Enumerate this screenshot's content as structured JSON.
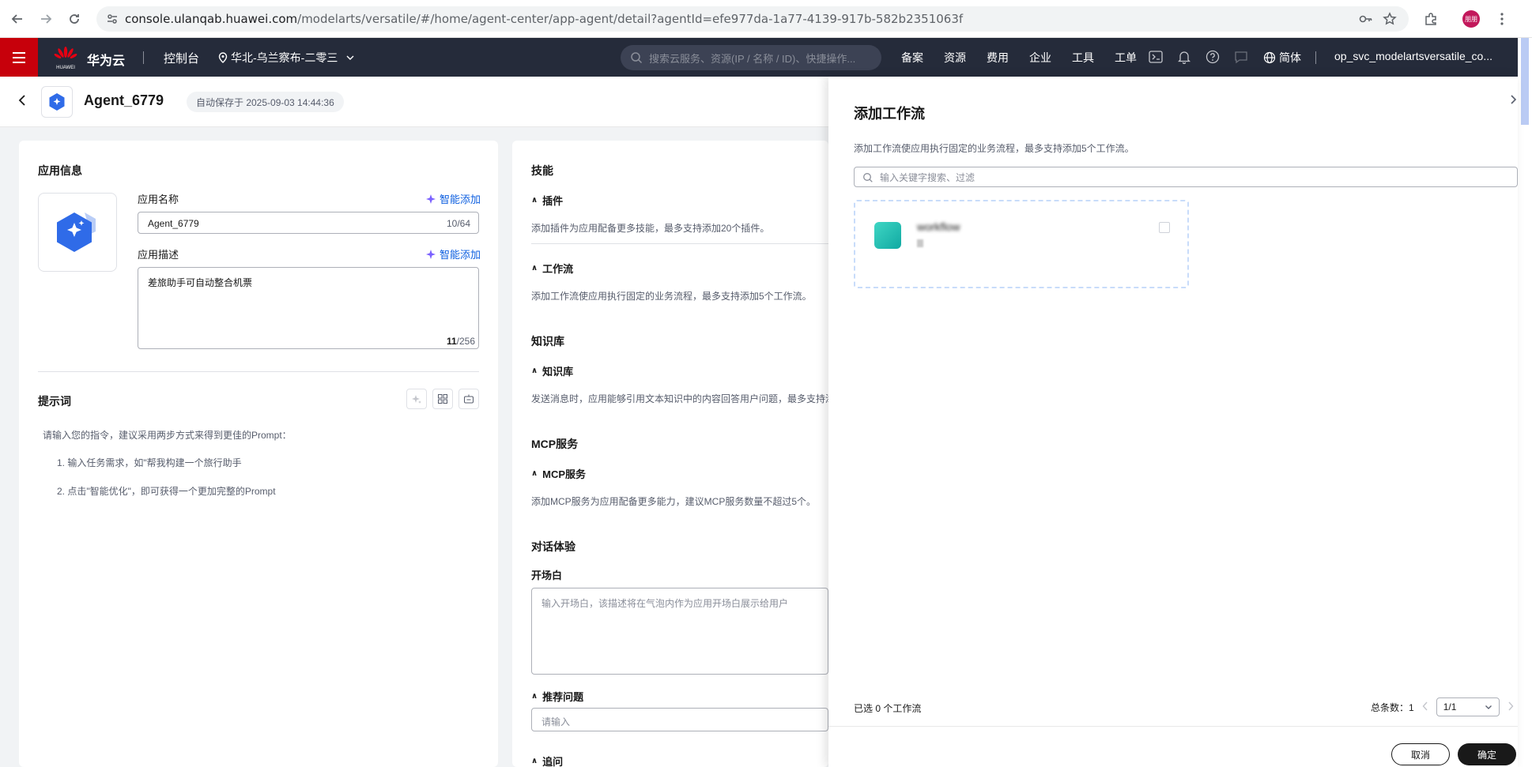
{
  "browser": {
    "url_host": "console.ulanqab.huawei.com",
    "url_path": "/modelarts/versatile/#/home/agent-center/app-agent/detail?agentId=efe977da-1a77-4139-917b-582b2351063f",
    "profile_label": "朋朋"
  },
  "header": {
    "brand": "华为云",
    "logo_text": "HUAWEI",
    "console": "控制台",
    "region": "华北-乌兰察布-二零三",
    "search_placeholder": "搜索云服务、资源(IP / 名称 / ID)、快捷操作...",
    "links": [
      "备案",
      "资源",
      "费用",
      "企业",
      "工具",
      "工单"
    ],
    "lang": "简体",
    "user": "op_svc_modelartsversatile_co..."
  },
  "subheader": {
    "agent_name": "Agent_6779",
    "autosave": "自动保存于 2025-09-03 14:44:36"
  },
  "app_info": {
    "title": "应用信息",
    "name_label": "应用名称",
    "ai_add": "智能添加",
    "name_value": "Agent_6779",
    "name_count": "10/64",
    "desc_label": "应用描述",
    "desc_value": "差旅助手可自动整合机票",
    "desc_count_num": "11",
    "desc_count_max": "/256"
  },
  "prompt": {
    "title": "提示词",
    "line1": "请输入您的指令，建议采用两步方式来得到更佳的Prompt：",
    "line2": "1. 输入任务需求，如\"帮我构建一个旅行助手",
    "line3": "2. 点击\"智能优化\"，即可获得一个更加完整的Prompt"
  },
  "skills": {
    "title": "技能",
    "plugin_title": "插件",
    "plugin_desc": "添加插件为应用配备更多技能，最多支持添加20个插件。",
    "workflow_title": "工作流",
    "workflow_desc": "添加工作流使应用执行固定的业务流程，最多支持添加5个工作流。",
    "kb_section": "知识库",
    "kb_title": "知识库",
    "kb_desc": "发送消息时，应用能够引用文本知识中的内容回答用户问题，最多支持添",
    "mcp_section": "MCP服务",
    "mcp_title": "MCP服务",
    "mcp_desc": "添加MCP服务为应用配备更多能力，建议MCP服务数量不超过5个。",
    "dialog_section": "对话体验",
    "opening_title": "开场白",
    "opening_placeholder": "输入开场白，该描述将在气泡内作为应用开场白展示给用户",
    "rec_title": "推荐问题",
    "rec_placeholder": "请输入",
    "more_title": "追问"
  },
  "drawer": {
    "title": "添加工作流",
    "desc": "添加工作流使应用执行固定的业务流程，最多支持添加5个工作流。",
    "search_placeholder": "输入关键字搜索、过滤",
    "item_name": "workflow",
    "selected": "已选 0 个工作流",
    "total_label": "总条数：",
    "total_value": "1",
    "page": "1/1",
    "cancel": "取消",
    "confirm": "确定"
  }
}
